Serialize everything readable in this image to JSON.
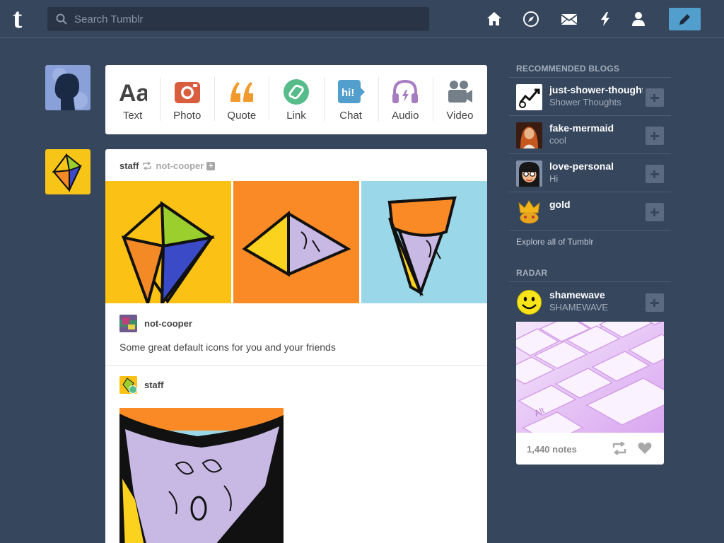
{
  "header": {
    "search_placeholder": "Search Tumblr",
    "nav_icons": [
      "home-icon",
      "explore-compass-icon",
      "inbox-mail-icon",
      "activity-lightning-icon",
      "account-person-icon"
    ],
    "compose_icon": "pencil-icon"
  },
  "composer": {
    "types": [
      {
        "label": "Text",
        "icon": "text-icon",
        "color": "#444444"
      },
      {
        "label": "Photo",
        "icon": "camera-icon",
        "color": "#d95e40"
      },
      {
        "label": "Quote",
        "icon": "quote-icon",
        "color": "#f2992e"
      },
      {
        "label": "Link",
        "icon": "link-icon",
        "color": "#56bc8a"
      },
      {
        "label": "Chat",
        "icon": "chat-icon",
        "color": "#529ecc"
      },
      {
        "label": "Audio",
        "icon": "headphones-icon",
        "color": "#a77dc2"
      },
      {
        "label": "Video",
        "icon": "video-camera-icon",
        "color": "#748089"
      }
    ]
  },
  "post": {
    "author": "staff",
    "reblog_source": "not-cooper",
    "reblog_user": "not-cooper",
    "caption": "Some great default icons for you and your friends",
    "second_user": "staff"
  },
  "sidebar": {
    "recommended_title": "RECOMMENDED BLOGS",
    "blogs": [
      {
        "name": "just-shower-thoughts",
        "sub": "Shower Thoughts"
      },
      {
        "name": "fake-mermaid",
        "sub": "cool"
      },
      {
        "name": "love-personal",
        "sub": "Hi"
      },
      {
        "name": "gold",
        "sub": ""
      }
    ],
    "explore_label": "Explore all of Tumblr",
    "radar_title": "RADAR",
    "radar": {
      "name": "shamewave",
      "sub": "SHAMEWAVE",
      "notes": "1,440 notes",
      "key_label": "Alt"
    }
  },
  "colors": {
    "background": "#36465d",
    "accent": "#529ecc"
  }
}
